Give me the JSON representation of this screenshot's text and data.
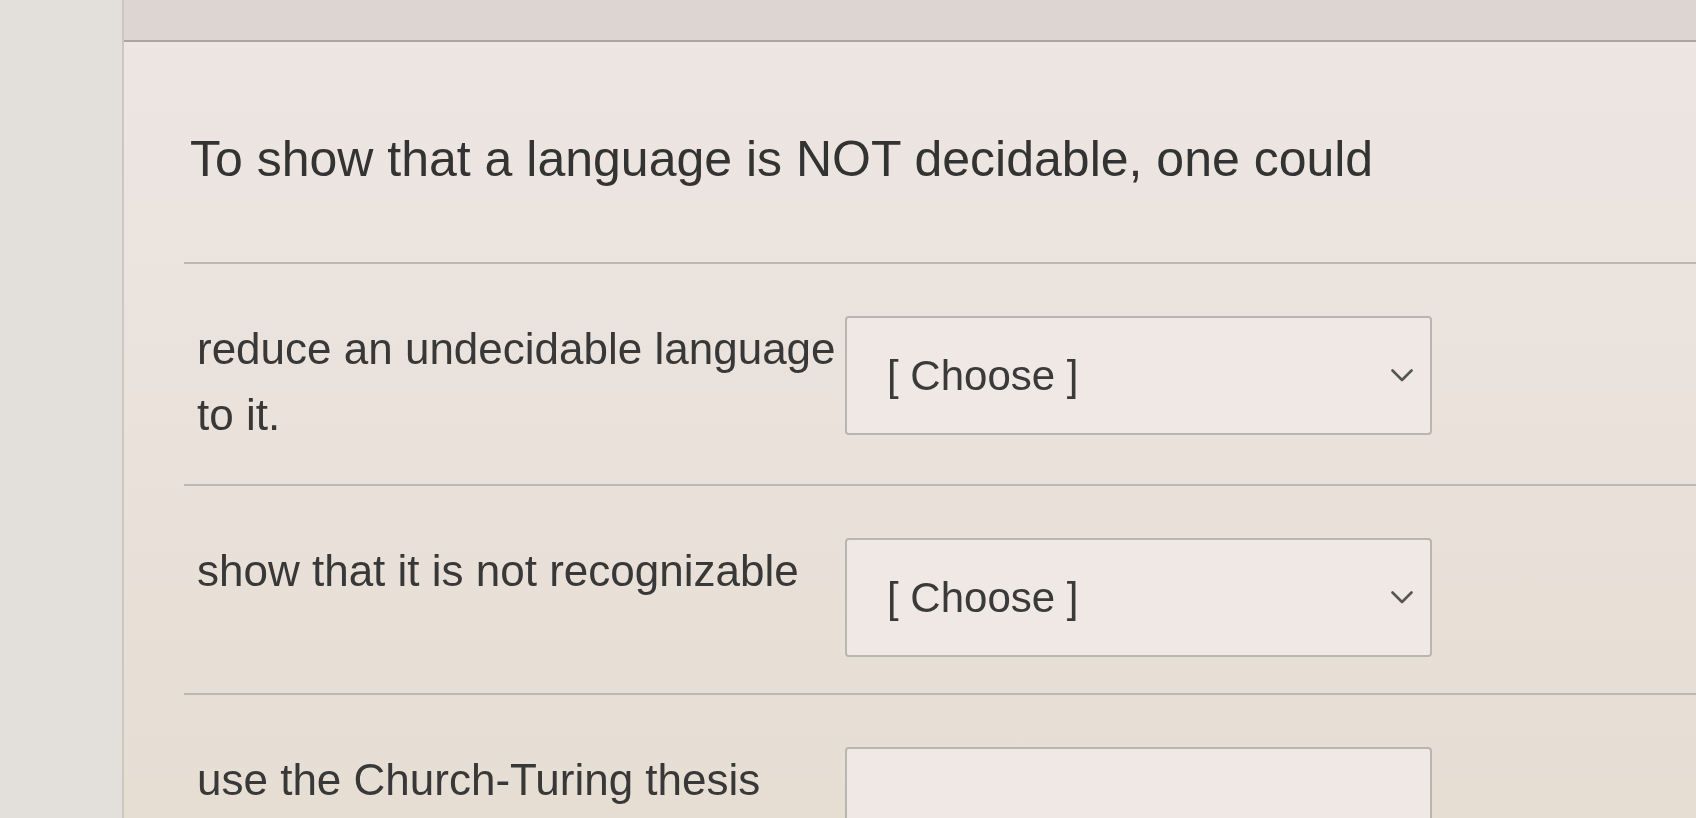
{
  "question": {
    "text": "To show that a language is NOT decidable, one could"
  },
  "rows": [
    {
      "label": "reduce an undecidable language to it.",
      "value": "[ Choose ]"
    },
    {
      "label": "show that it is not recognizable",
      "value": "[ Choose ]"
    },
    {
      "label": "use the Church-Turing thesis"
    }
  ]
}
